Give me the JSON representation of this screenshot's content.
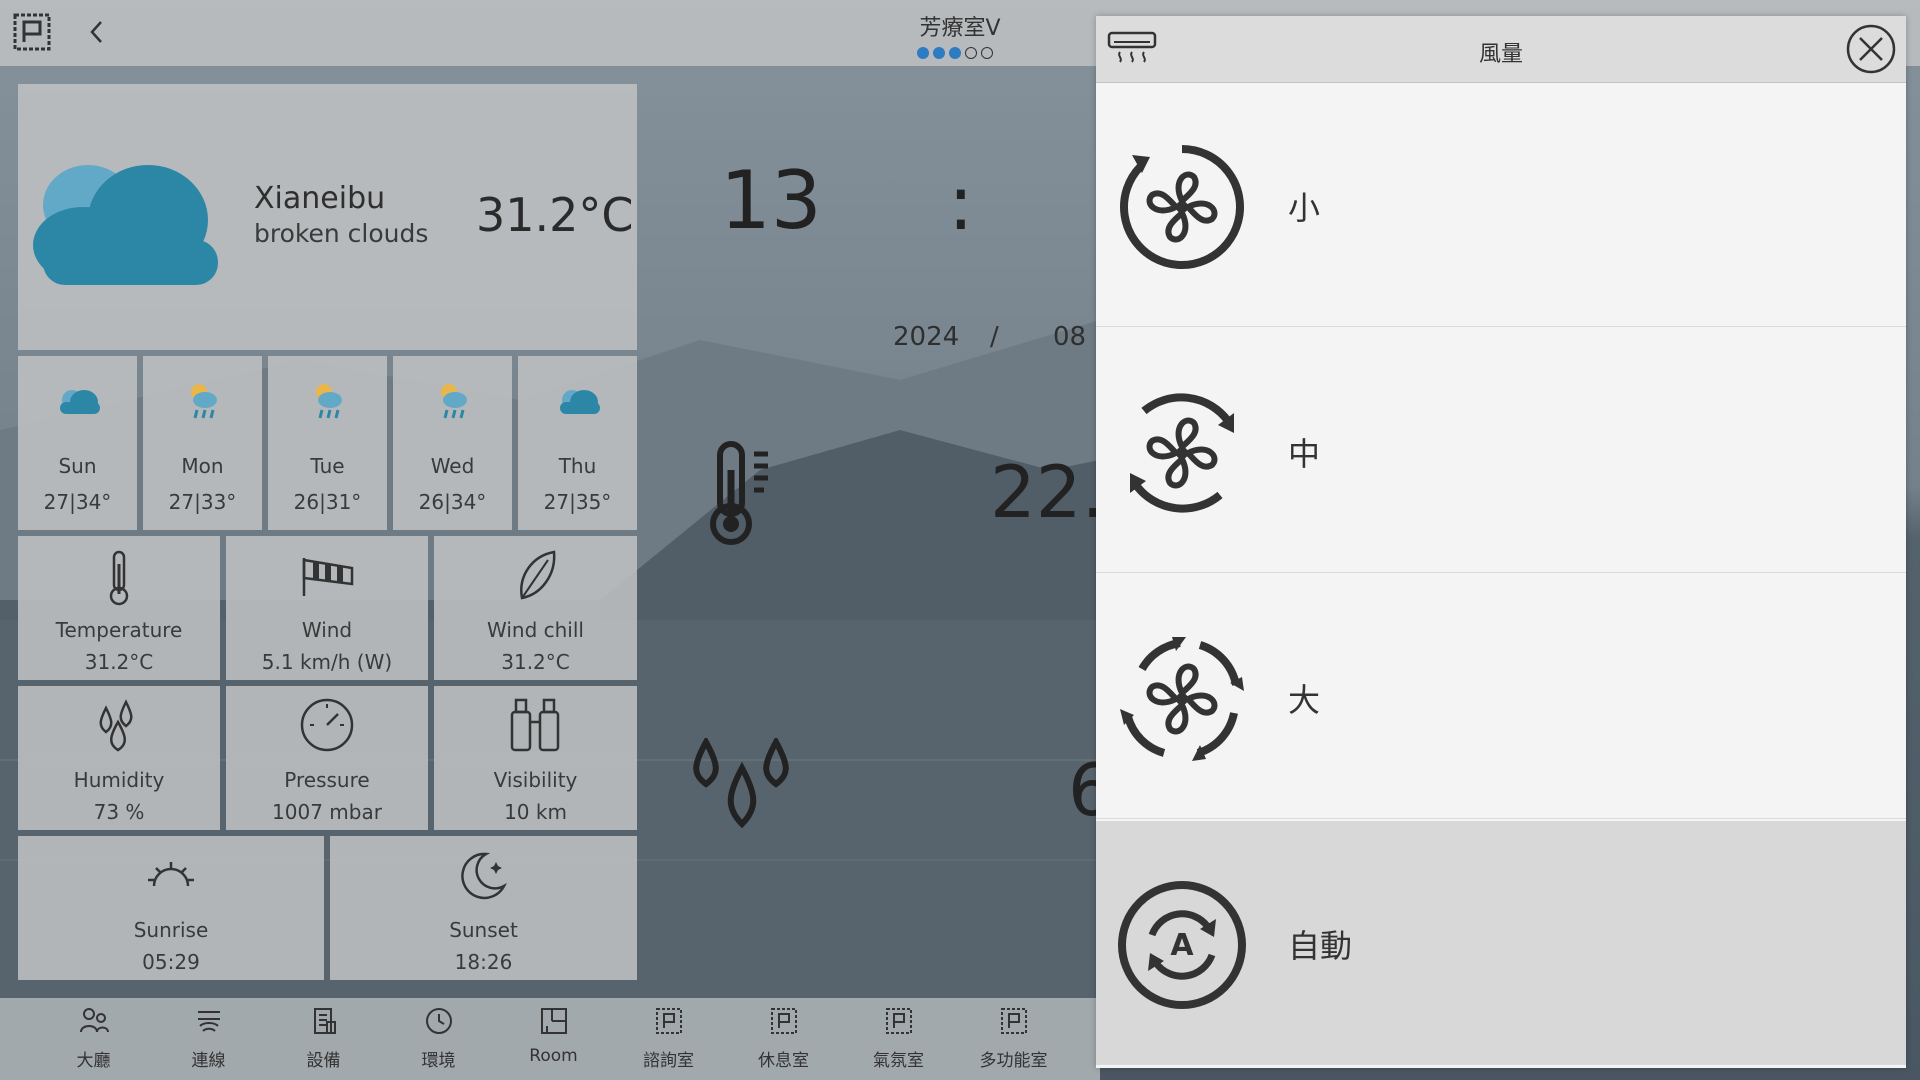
{
  "topbar": {
    "room_title": "芳療室V",
    "page_dots": [
      true,
      true,
      true,
      false,
      false
    ]
  },
  "weather": {
    "current": {
      "city": "Xianeibu",
      "condition": "broken clouds",
      "temperature": "31.2°C",
      "icon": "cloud-icon"
    },
    "forecast": [
      {
        "day": "Sun",
        "range": "27|34°",
        "icon": "cloud-icon"
      },
      {
        "day": "Mon",
        "range": "27|33°",
        "icon": "sun-rain-icon"
      },
      {
        "day": "Tue",
        "range": "26|31°",
        "icon": "sun-rain-icon"
      },
      {
        "day": "Wed",
        "range": "26|34°",
        "icon": "sun-rain-icon"
      },
      {
        "day": "Thu",
        "range": "27|35°",
        "icon": "cloud-icon"
      }
    ],
    "details": [
      {
        "label": "Temperature",
        "value": "31.2°C",
        "icon": "thermometer-icon"
      },
      {
        "label": "Wind",
        "value": "5.1 km/h (W)",
        "icon": "windsock-icon"
      },
      {
        "label": "Wind chill",
        "value": "31.2°C",
        "icon": "leaf-icon"
      },
      {
        "label": "Humidity",
        "value": "73 %",
        "icon": "droplets-icon"
      },
      {
        "label": "Pressure",
        "value": "1007 mbar",
        "icon": "gauge-icon"
      },
      {
        "label": "Visibility",
        "value": "10 km",
        "icon": "binoculars-icon"
      }
    ],
    "sun": [
      {
        "label": "Sunrise",
        "value": "05:29",
        "icon": "sunrise-icon"
      },
      {
        "label": "Sunset",
        "value": "18:26",
        "icon": "moon-icon"
      }
    ]
  },
  "clock": {
    "hour": "13",
    "separator": ":",
    "year": "2024",
    "date_sep": "/",
    "month": "08"
  },
  "sensors": {
    "temperature_partial": "22.",
    "humidity_partial": "6"
  },
  "nav": [
    {
      "label": "大廳",
      "icon": "people-icon"
    },
    {
      "label": "連線",
      "icon": "connection-icon"
    },
    {
      "label": "設備",
      "icon": "device-icon"
    },
    {
      "label": "環境",
      "icon": "clock-icon"
    },
    {
      "label": "Room",
      "icon": "room-icon"
    },
    {
      "label": "諮詢室",
      "icon": "room-icon"
    },
    {
      "label": "休息室",
      "icon": "room-icon"
    },
    {
      "label": "氣氛室",
      "icon": "room-icon"
    },
    {
      "label": "多功能室",
      "icon": "room-icon"
    }
  ],
  "modal": {
    "title": "風量",
    "options": [
      {
        "label": "小",
        "icon": "fan-low-icon",
        "selected": false
      },
      {
        "label": "中",
        "icon": "fan-mid-icon",
        "selected": false
      },
      {
        "label": "大",
        "icon": "fan-high-icon",
        "selected": false
      },
      {
        "label": "自動",
        "icon": "fan-auto-icon",
        "selected": true
      }
    ]
  }
}
